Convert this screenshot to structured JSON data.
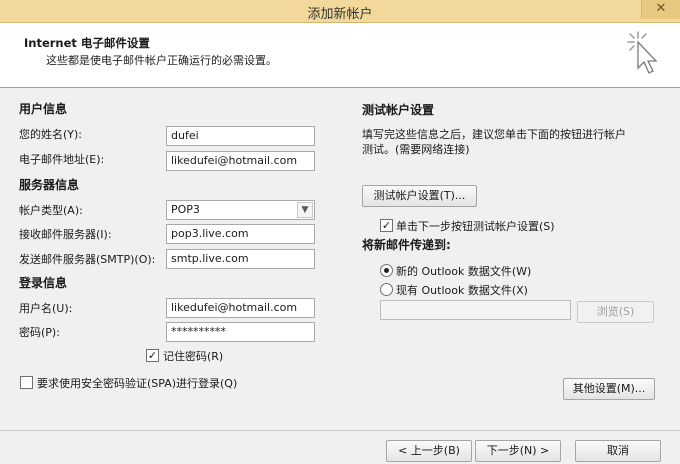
{
  "window": {
    "title": "添加新帐户",
    "close_glyph": "✕"
  },
  "header": {
    "title": "Internet 电子邮件设置",
    "subtitle": "这些都是使电子邮件帐户正确运行的必需设置。"
  },
  "user_info": {
    "heading": "用户信息",
    "name_label": "您的姓名(Y):",
    "name_value": "dufei",
    "email_label": "电子邮件地址(E):",
    "email_value": "likedufei@hotmail.com"
  },
  "server_info": {
    "heading": "服务器信息",
    "type_label": "帐户类型(A):",
    "type_value": "POP3",
    "incoming_label": "接收邮件服务器(I):",
    "incoming_value": "pop3.live.com",
    "outgoing_label": "发送邮件服务器(SMTP)(O):",
    "outgoing_value": "smtp.live.com"
  },
  "login_info": {
    "heading": "登录信息",
    "username_label": "用户名(U):",
    "username_value": "likedufei@hotmail.com",
    "password_label": "密码(P):",
    "password_value": "**********",
    "remember_label": "记住密码(R)",
    "remember_checked": true,
    "spa_label": "要求使用安全密码验证(SPA)进行登录(Q)",
    "spa_checked": false
  },
  "test": {
    "heading": "测试帐户设置",
    "description_line1": "填写完这些信息之后，建议您单击下面的按钮进行帐户",
    "description_line2": "测试。(需要网络连接)",
    "test_button": "测试帐户设置(T)...",
    "auto_test_label": "单击下一步按钮测试帐户设置(S)",
    "auto_test_checked": true,
    "deliver_heading": "将新邮件传递到:",
    "new_file_label": "新的 Outlook 数据文件(W)",
    "existing_file_label": "现有 Outlook 数据文件(X)",
    "existing_path_value": "",
    "browse_button": "浏览(S)",
    "more_settings_button": "其他设置(M)..."
  },
  "footer": {
    "back_button": "< 上一步(B)",
    "next_button": "下一步(N) >",
    "cancel_button": "取消"
  }
}
